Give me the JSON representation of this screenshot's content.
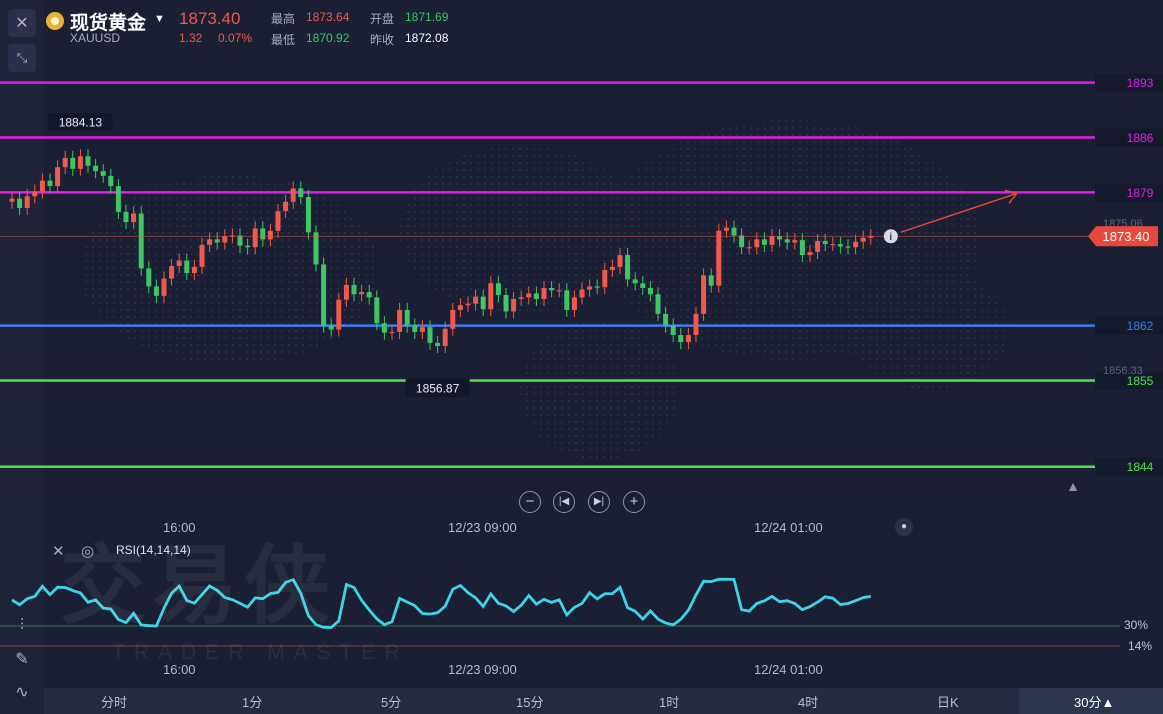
{
  "header": {
    "title": "现货黄金",
    "symbol": "XAUUSD",
    "price": "1873.40",
    "change": "1.32",
    "change_pct": "0.07%",
    "high_label": "最高",
    "high": "1873.64",
    "open_label": "开盘",
    "open": "1871.69",
    "low_label": "最低",
    "low": "1870.92",
    "prev_label": "昨收",
    "prev": "1872.08"
  },
  "chart_data": [
    {
      "type": "candlestick",
      "ylim": [
        1839.5,
        1895.5
      ],
      "x_ticks": [
        "16:00",
        "12/23 09:00",
        "12/24 01:00"
      ],
      "y_ticks_faded": [
        "1875.06",
        "1856.33"
      ],
      "current_price": "1873.40",
      "annotations": [
        {
          "label": "1884.13",
          "value": 1884.13
        },
        {
          "label": "1856.87",
          "value": 1856.87
        }
      ],
      "levels": [
        {
          "label": "1893",
          "value": 1893,
          "color": "#e21ee8"
        },
        {
          "label": "1886",
          "value": 1886,
          "color": "#e21ee8"
        },
        {
          "label": "1879",
          "value": 1879,
          "color": "#e21ee8"
        },
        {
          "label": "1862",
          "value": 1862,
          "color": "#3a7ff0"
        },
        {
          "label": "1855",
          "value": 1855,
          "color": "#4ee24a"
        },
        {
          "label": "1844",
          "value": 1844,
          "color": "#4ee24a"
        }
      ],
      "close": [
        1878.2,
        1877.0,
        1878.5,
        1879.1,
        1880.5,
        1879.8,
        1882.2,
        1883.4,
        1882.0,
        1883.6,
        1882.4,
        1881.7,
        1881.1,
        1879.8,
        1876.5,
        1875.2,
        1876.3,
        1869.3,
        1867.0,
        1865.8,
        1868.0,
        1869.6,
        1870.3,
        1868.7,
        1869.5,
        1872.3,
        1873.0,
        1872.6,
        1873.4,
        1873.5,
        1872.2,
        1872.0,
        1874.4,
        1873.0,
        1874.1,
        1876.6,
        1877.8,
        1879.5,
        1878.4,
        1873.9,
        1869.8,
        1862.0,
        1861.5,
        1865.3,
        1867.2,
        1866.0,
        1866.3,
        1865.6,
        1862.3,
        1861.1,
        1861.2,
        1864.0,
        1862.0,
        1861.2,
        1861.8,
        1859.8,
        1859.4,
        1861.6,
        1864.0,
        1864.6,
        1864.8,
        1865.7,
        1864.1,
        1867.4,
        1865.9,
        1863.8,
        1865.4,
        1865.6,
        1866.1,
        1865.4,
        1866.8,
        1866.5,
        1866.5,
        1864.0,
        1865.6,
        1866.6,
        1867.0,
        1866.9,
        1869.1,
        1869.5,
        1871.0,
        1867.9,
        1867.4,
        1866.8,
        1866.0,
        1863.5,
        1862.0,
        1860.8,
        1859.9,
        1860.8,
        1863.5,
        1868.4,
        1867.1,
        1874.1,
        1874.5,
        1873.5,
        1872.0,
        1872.0,
        1873.0,
        1872.3,
        1873.4,
        1873.0,
        1872.6,
        1872.9,
        1871.0,
        1871.4,
        1872.8,
        1872.4,
        1872.4,
        1872.1,
        1872.0,
        1872.7,
        1873.2,
        1873.4
      ],
      "rsi_series": {
        "name": "RSI(14,14,14)",
        "levels": [
          "30%",
          "14%"
        ]
      }
    }
  ],
  "x_ticks_lower": [
    "16:00",
    "12/23 09:00",
    "12/24 01:00"
  ],
  "timeframes": [
    "分时",
    "1分",
    "5分",
    "15分",
    "1时",
    "4时",
    "日K",
    "30分▲"
  ],
  "watermark": {
    "main": "交易侠",
    "sub": "TRADER MASTER"
  }
}
